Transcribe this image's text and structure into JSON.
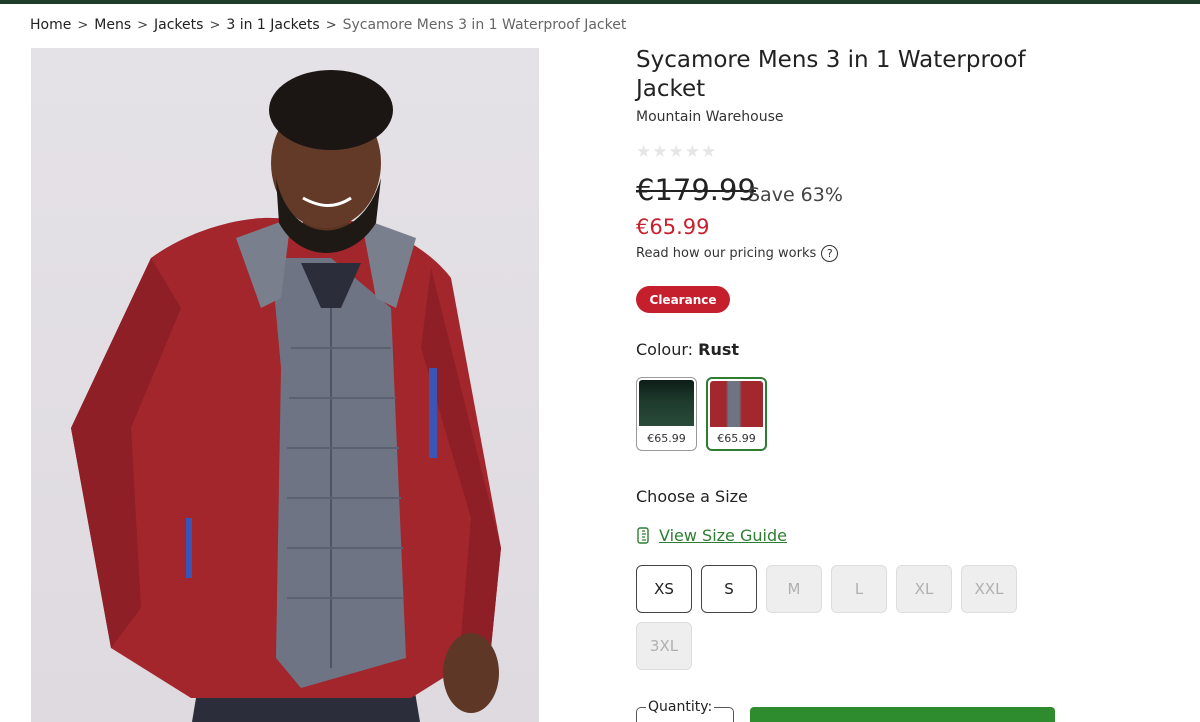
{
  "breadcrumb": {
    "items": [
      {
        "label": "Home"
      },
      {
        "label": "Mens"
      },
      {
        "label": "Jackets"
      },
      {
        "label": "3 in 1 Jackets"
      },
      {
        "label": "Sycamore Mens 3 in 1 Waterproof Jacket"
      }
    ],
    "separator": ">"
  },
  "product": {
    "title": "Sycamore Mens 3 in 1 Waterproof Jacket",
    "brand": "Mountain Warehouse",
    "rating": {
      "value": 0,
      "max": 5,
      "icon": "star-icon"
    },
    "was_price": "€179.99",
    "save_text": "Save 63%",
    "now_price": "€65.99",
    "pricing_link": "Read how our pricing works",
    "pricing_help_icon": "?",
    "badge": "Clearance",
    "colour_label": "Colour:",
    "colour_value": "Rust",
    "swatches": [
      {
        "name": "Green",
        "price": "€65.99",
        "color": "#1d3a2c",
        "selected": false
      },
      {
        "name": "Rust",
        "price": "€65.99",
        "color": "#a2282e",
        "selected": true
      }
    ],
    "size_label": "Choose a Size",
    "size_guide": "View Size Guide",
    "sizes": [
      {
        "label": "XS",
        "available": true
      },
      {
        "label": "S",
        "available": true
      },
      {
        "label": "M",
        "available": false
      },
      {
        "label": "L",
        "available": false
      },
      {
        "label": "XL",
        "available": false
      },
      {
        "label": "XXL",
        "available": false
      },
      {
        "label": "3XL",
        "available": false
      }
    ],
    "quantity_label": "Quantity:"
  },
  "colors": {
    "accent_green": "#2e7d32",
    "sale_red": "#c8202f",
    "badge_red": "#c51f2e",
    "header_bar": "#1f3d2a"
  }
}
